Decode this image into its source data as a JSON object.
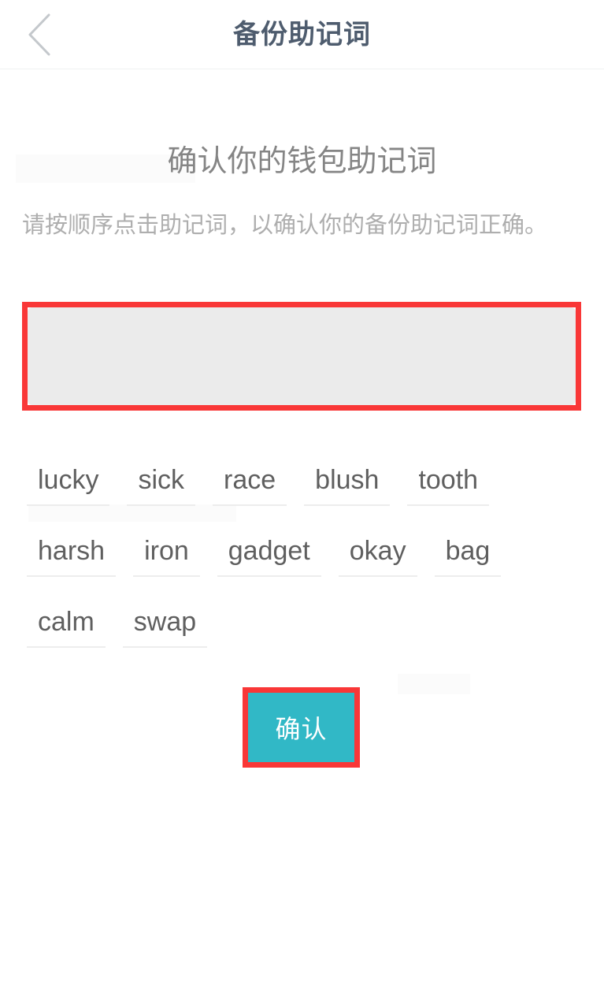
{
  "header": {
    "back_icon": "chevron-left-icon",
    "title": "备份助记词"
  },
  "main": {
    "title": "确认你的钱包助记词",
    "subtitle": "请按顺序点击助记词，以确认你的备份助记词正确。",
    "selected_words": [],
    "selected_box_placeholder": "",
    "word_bank_rows": [
      [
        "lucky",
        "sick",
        "race",
        "blush",
        "tooth"
      ],
      [
        "harsh",
        "iron",
        "gadget",
        "okay",
        "bag"
      ],
      [
        "calm",
        "swap"
      ]
    ],
    "confirm_label": "确认"
  },
  "colors": {
    "accent_teal": "#31b8c6",
    "highlight_red": "#f93737",
    "header_title": "#4e5c6e",
    "body_text": "#5f5f5f",
    "muted_text": "#aeaeae",
    "box_fill": "#ebebeb"
  }
}
